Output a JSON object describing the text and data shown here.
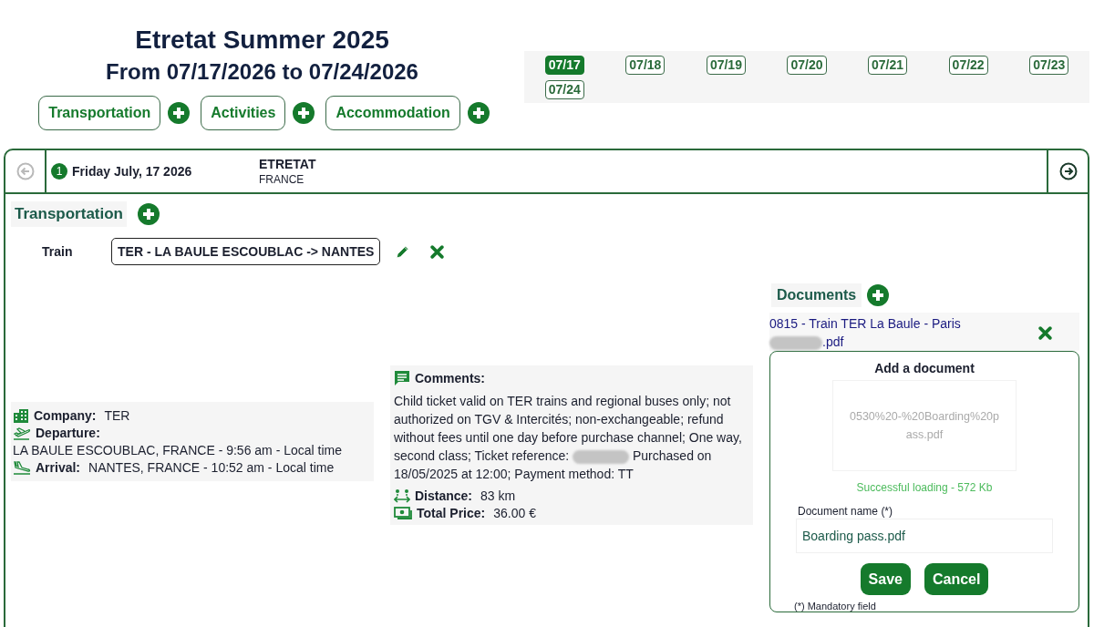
{
  "trip": {
    "title": "Etretat Summer 2025",
    "dates": "From 07/17/2026 to 07/24/2026"
  },
  "categories": [
    {
      "label": "Transportation"
    },
    {
      "label": "Activities"
    },
    {
      "label": "Accommodation"
    }
  ],
  "days": [
    {
      "label": "07/17",
      "selected": true
    },
    {
      "label": "07/18",
      "selected": false
    },
    {
      "label": "07/19",
      "selected": false
    },
    {
      "label": "07/20",
      "selected": false
    },
    {
      "label": "07/21",
      "selected": false
    },
    {
      "label": "07/22",
      "selected": false
    },
    {
      "label": "07/23",
      "selected": false
    },
    {
      "label": "07/24",
      "selected": false
    }
  ],
  "day_header": {
    "number": "1",
    "date": "Friday July, 17 2026",
    "place": "ETRETAT",
    "country": "FRANCE"
  },
  "section": {
    "title": "Transportation"
  },
  "item": {
    "type": "Train",
    "name": "TER - LA BAULE ESCOUBLAC -> NANTES"
  },
  "details": [
    {
      "kind": "company",
      "label": "Company:",
      "value": "TER"
    },
    {
      "kind": "departure",
      "label": "Departure:",
      "value": "LA BAULE ESCOUBLAC, FRANCE - 9:56 am - Local time"
    },
    {
      "kind": "arrival",
      "label": "Arrival:",
      "value": "NANTES, FRANCE - 10:52 am - Local time"
    }
  ],
  "comments": {
    "label": "Comments:",
    "text_before": "Child ticket valid on TER trains and regional buses only; not authorized on TGV & Intercités; non-exchangeable; refund without fees until one day before purchase channel; One way, second class; Ticket reference:",
    "text_after": "Purchased on 18/05/2025 at 12:00; Payment method: TT"
  },
  "extras": [
    {
      "kind": "distance",
      "label": "Distance:",
      "value": "83 km"
    },
    {
      "kind": "price",
      "label": "Total Price:",
      "value": "36.00 €"
    }
  ],
  "documents": {
    "title": "Documents",
    "files": [
      {
        "name_before": "0815 - Train TER La Baule - Paris",
        "name_after": ".pdf"
      }
    ]
  },
  "upload": {
    "title": "Add a document",
    "file": "0530%20-%20Boarding%20pass.pdf",
    "status": "Successful loading - 572 Kb",
    "field_label": "Document name (*)",
    "value": "Boarding pass.pdf",
    "buttons": [
      "Save",
      "Cancel"
    ],
    "note": "(*) Mandatory field"
  }
}
